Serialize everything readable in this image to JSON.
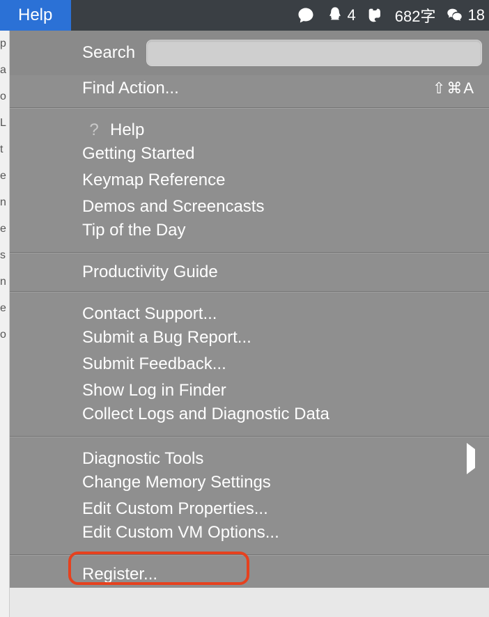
{
  "menubar": {
    "help_title": "Help",
    "status": {
      "qq_count": "4",
      "word_count": "682字",
      "wechat_count": "18"
    }
  },
  "menu": {
    "search_label": "Search",
    "search_placeholder": "",
    "find_action": {
      "label": "Find Action...",
      "shortcut": "⇧⌘A"
    },
    "help": "Help",
    "getting_started": "Getting Started",
    "keymap_reference": "Keymap Reference",
    "demos": "Demos and Screencasts",
    "tip_of_day": "Tip of the Day",
    "productivity_guide": "Productivity Guide",
    "contact_support": "Contact Support...",
    "submit_bug": "Submit a Bug Report...",
    "submit_feedback": "Submit Feedback...",
    "show_log": "Show Log in Finder",
    "collect_logs": "Collect Logs and Diagnostic Data",
    "diagnostic_tools": "Diagnostic Tools",
    "change_memory": "Change Memory Settings",
    "edit_props": "Edit Custom Properties...",
    "edit_vm": "Edit Custom VM Options...",
    "register": "Register..."
  },
  "left_text": "p a o L t e n e s n e o"
}
